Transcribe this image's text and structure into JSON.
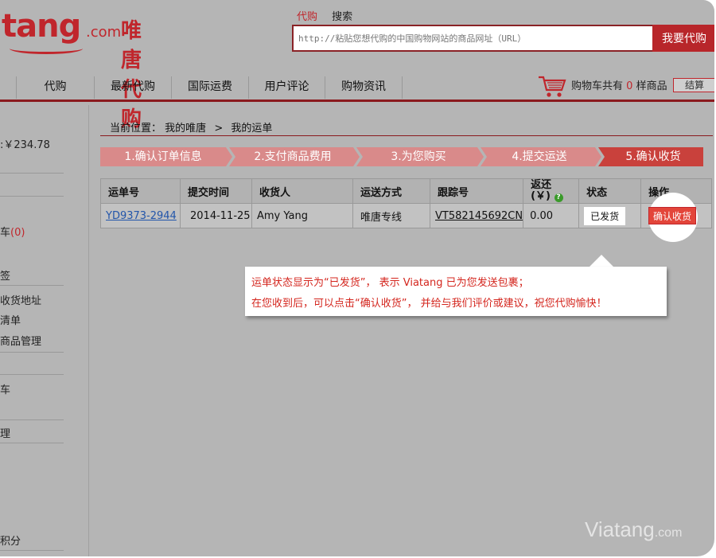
{
  "colors": {
    "brand_red": "#c0262c",
    "dark_red": "#8a1a1e",
    "link_blue": "#2255aa",
    "background": "#b5b5b5"
  },
  "header": {
    "logo_text": "tang",
    "logo_com": ".com",
    "logo_cn": "唯唐代购",
    "search_tabs": [
      "代购",
      "搜索"
    ],
    "search_placeholder": "http://粘贴您想代购的中国购物网站的商品网址（URL）",
    "search_button": "我要代购"
  },
  "nav": {
    "items": [
      "代购",
      "最新代购",
      "国际运费",
      "用户评论",
      "购物资讯"
    ],
    "cart_prefix": "购物车共有",
    "cart_count": "0",
    "cart_suffix": "样商品",
    "checkout_label": "结算"
  },
  "sidebar": {
    "balance": ":￥234.78",
    "cart_link": "车",
    "cart_link_count": "(0)",
    "section_b": "签",
    "address": "收货地址",
    "list": "清单",
    "goods_manage": "商品管理",
    "cart_2": "车",
    "section_c": "理",
    "points": "积分"
  },
  "breadcrumb": {
    "prefix": "当前位置：",
    "home": "我的唯唐",
    "separator": ">",
    "current": "我的运单"
  },
  "steps": [
    "1.确认订单信息",
    "2.支付商品费用",
    "3.为您购买",
    "4.提交运送",
    "5.确认收货"
  ],
  "table": {
    "headers": [
      "运单号",
      "提交时间",
      "收货人",
      "运送方式",
      "跟踪号",
      "返还",
      "(￥)",
      "状态",
      "操作"
    ],
    "row": {
      "order_no": "YD9373-2944",
      "date": "2014-11-25",
      "receiver": "Amy Yang",
      "shipping": "唯唐专线",
      "tracking": "VT582145692CN",
      "refund": "0.00",
      "status": "已发货",
      "action": "确认收货"
    }
  },
  "tooltip": {
    "line1": "运单状态显示为“已发货”， 表示  Viatang 已为您发送包裹；",
    "line2": "在您收到后，可以点击“确认收货”， 并给与我们评价或建议，祝您代购愉快！"
  },
  "watermark": {
    "main": "Viatang",
    "suffix": ".com"
  }
}
